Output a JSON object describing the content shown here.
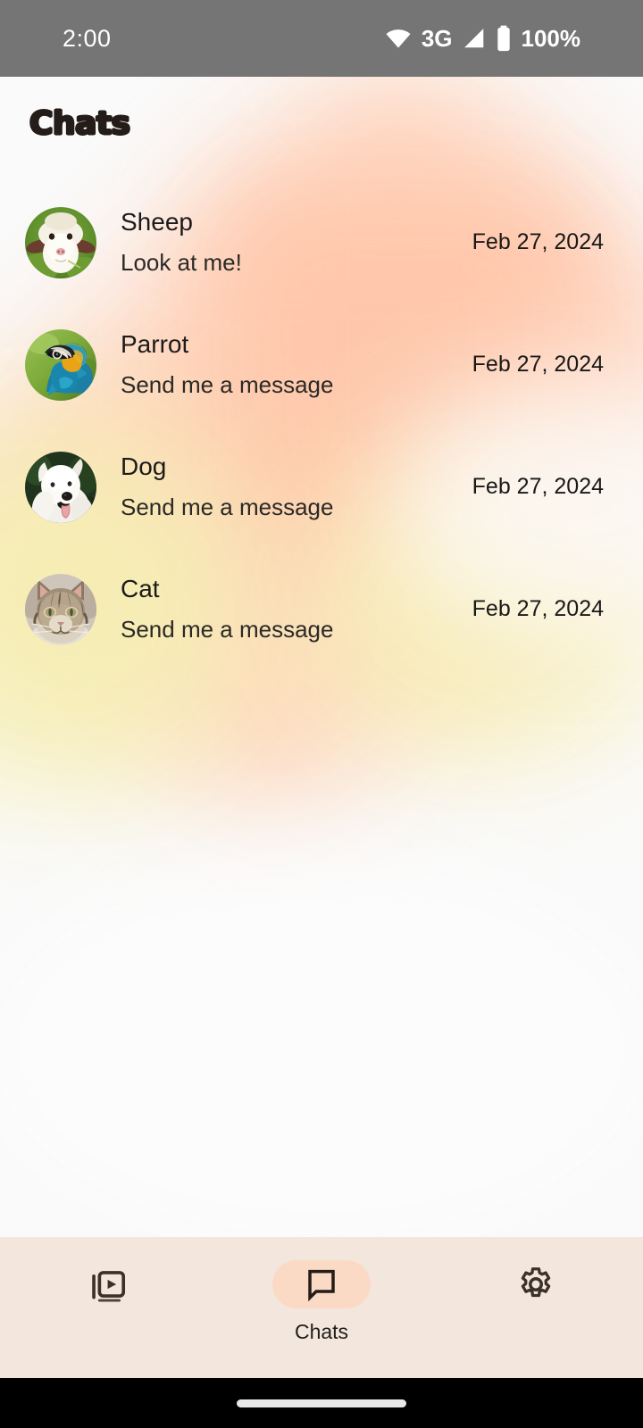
{
  "statusbar": {
    "time": "2:00",
    "network": "3G",
    "battery": "100%",
    "wifi_icon": "wifi-icon",
    "signal_icon": "signal-icon",
    "battery_icon": "battery-full-icon"
  },
  "header": {
    "title": "Chats"
  },
  "chats": [
    {
      "name": "Sheep",
      "message": "Look at me!",
      "date": "Feb 27, 2024",
      "avatar": "sheep-avatar"
    },
    {
      "name": "Parrot",
      "message": "Send me a message",
      "date": "Feb 27, 2024",
      "avatar": "parrot-avatar"
    },
    {
      "name": "Dog",
      "message": "Send me a message",
      "date": "Feb 27, 2024",
      "avatar": "dog-avatar"
    },
    {
      "name": "Cat",
      "message": "Send me a message",
      "date": "Feb 27, 2024",
      "avatar": "cat-avatar"
    }
  ],
  "bottomnav": {
    "items": [
      {
        "label": "",
        "icon": "media-slideshow-icon",
        "active": false
      },
      {
        "label": "Chats",
        "icon": "chat-bubble-icon",
        "active": true
      },
      {
        "label": "",
        "icon": "gear-icon",
        "active": false
      }
    ]
  },
  "colors": {
    "statusbar_bg": "#757575",
    "nav_bg": "#F3E6DC",
    "nav_active_pill": "#FBDAC5",
    "title_text": "#241C18",
    "bg_peach": "#FFD3BB",
    "bg_yellow": "#F6EEB4",
    "gesture_bar_bg": "#000000"
  }
}
